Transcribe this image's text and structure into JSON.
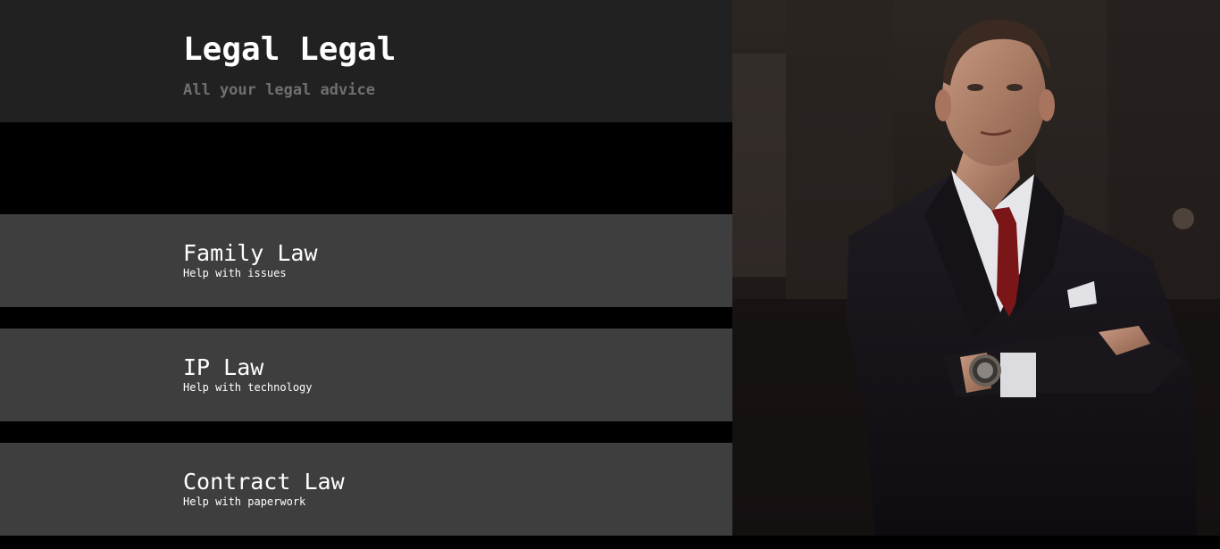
{
  "header": {
    "title": "Legal Legal",
    "subtitle": "All your legal advice"
  },
  "services": [
    {
      "title": "Family Law",
      "description": "Help with issues"
    },
    {
      "title": "IP Law",
      "description": "Help with technology"
    },
    {
      "title": "Contract Law",
      "description": "Help with paperwork"
    }
  ],
  "colors": {
    "header_bg": "#212121",
    "card_bg": "#3e3e3e",
    "page_bg": "#000000",
    "subtitle": "#6f6f6f",
    "text": "#ffffff"
  },
  "hero_image": {
    "icon": "lawyer-portrait-photo"
  }
}
